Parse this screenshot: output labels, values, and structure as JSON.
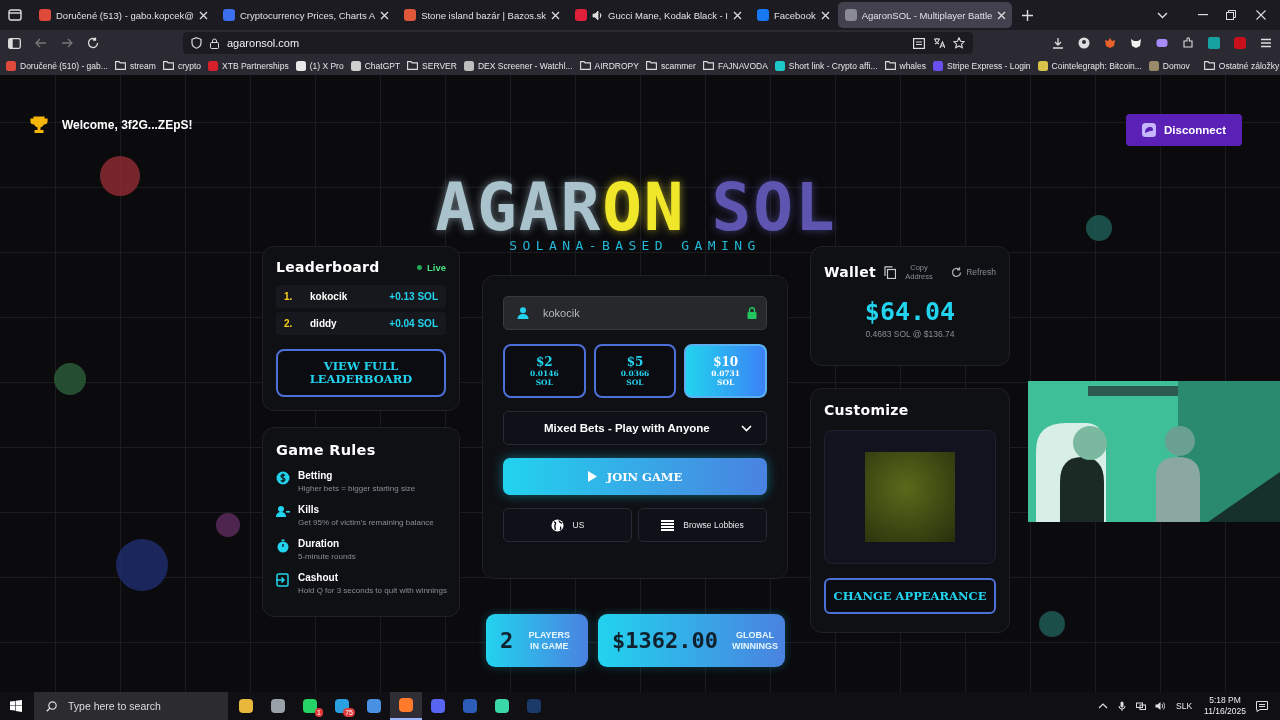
{
  "browser": {
    "tabs": [
      {
        "title": "Doručené (513) - gabo.kopcek@",
        "color": "#e04a3a",
        "audio": false,
        "selected": false
      },
      {
        "title": "Cryptocurrency Prices, Charts A",
        "color": "#3b6ff0",
        "audio": false,
        "selected": false
      },
      {
        "title": "Stone island bazár | Bazos.sk",
        "color": "#e0583a",
        "audio": false,
        "selected": false
      },
      {
        "title": "Gucci Mane, Kodak Black - I",
        "color": "#e0203a",
        "audio": true,
        "selected": false
      },
      {
        "title": "Facebook",
        "color": "#1877f2",
        "audio": false,
        "selected": false
      },
      {
        "title": "AgaronSOL - Multiplayer Battle",
        "color": "#8a8a96",
        "audio": false,
        "selected": true
      }
    ],
    "address": "agaronsol.com",
    "bookmarks": [
      {
        "label": "Doručené (510) - gab...",
        "kind": "site",
        "color": "#e04a3a"
      },
      {
        "label": "stream",
        "kind": "folder"
      },
      {
        "label": "crypto",
        "kind": "folder"
      },
      {
        "label": "XTB Partnerships",
        "kind": "site",
        "color": "#d8202a"
      },
      {
        "label": "(1) X Pro",
        "kind": "site",
        "color": "#e8e8e8"
      },
      {
        "label": "ChatGPT",
        "kind": "site",
        "color": "#cfcfcf"
      },
      {
        "label": "SERVER",
        "kind": "folder"
      },
      {
        "label": "DEX Screener - Watchl...",
        "kind": "site",
        "color": "#bdbdbd"
      },
      {
        "label": "AIRDROPY",
        "kind": "folder"
      },
      {
        "label": "scammer",
        "kind": "folder"
      },
      {
        "label": "FAJNAVODA",
        "kind": "folder"
      },
      {
        "label": "Short link - Crypto affi...",
        "kind": "site",
        "color": "#1ec8c8"
      },
      {
        "label": "whales",
        "kind": "folder"
      },
      {
        "label": "Stripe Express - Login",
        "kind": "site",
        "color": "#6a4ff0"
      },
      {
        "label": "Cointelegraph: Bitcoin...",
        "kind": "site",
        "color": "#d8c24a"
      },
      {
        "label": "Domov",
        "kind": "site",
        "color": "#9a8a6a"
      }
    ],
    "other_bookmarks": "Ostatné záložky"
  },
  "page": {
    "welcome": "Welcome, 3f2G...ZEpS!",
    "disconnect": "Disconnect",
    "logo": [
      {
        "text": "AGAR",
        "color": "#a9c2cc"
      },
      {
        "text": "ON",
        "color": "#f0e62a"
      },
      {
        "text": "SOL",
        "color": "#5e55b0"
      }
    ],
    "tagline": "SOLANA-BASED GAMING",
    "leaderboard": {
      "title": "Leaderboard",
      "status": "Live",
      "rows": [
        {
          "rank": "1.",
          "name": "kokocik",
          "amount": "+0.13 SOL"
        },
        {
          "rank": "2.",
          "name": "diddy",
          "amount": "+0.04 SOL"
        }
      ],
      "button": "VIEW FULL LEADERBOARD"
    },
    "rules": {
      "title": "Game Rules",
      "items": [
        {
          "kind": "betting",
          "title": "Betting",
          "text": "Higher bets = bigger starting size"
        },
        {
          "kind": "kills",
          "title": "Kills",
          "text": "Get 95% of victim's remaining balance"
        },
        {
          "kind": "duration",
          "title": "Duration",
          "text": "5-minute rounds"
        },
        {
          "kind": "cashout",
          "title": "Cashout",
          "text": "Hold Q for 3 seconds to quit with winnings"
        }
      ]
    },
    "username": "kokocik",
    "bets": [
      {
        "amount": "$2",
        "sol": "0.0146 SOL",
        "selected": false
      },
      {
        "amount": "$5",
        "sol": "0.0366 SOL",
        "selected": false
      },
      {
        "amount": "$10",
        "sol": "0.0731 SOL",
        "selected": true
      }
    ],
    "mode": "Mixed Bets - Play with Anyone",
    "join": "JOIN GAME",
    "region": "US",
    "browse": "Browse Lobbies",
    "stats": [
      {
        "value": "2",
        "label": "PLAYERS IN GAME"
      },
      {
        "value": "$1362.00",
        "label": "GLOBAL WINNINGS"
      }
    ],
    "wallet": {
      "title": "Wallet",
      "copy": "Copy Address",
      "refresh": "Refresh",
      "balance": "$64.04",
      "rate": "0.4683 SOL @ $136.74"
    },
    "customize": {
      "title": "Customize",
      "button": "CHANGE APPEARANCE"
    }
  },
  "taskbar": {
    "search_placeholder": "Type here to search",
    "apps": [
      {
        "color": "#e8b83a",
        "active": false
      },
      {
        "color": "#9aa0a8",
        "active": false
      },
      {
        "color": "#25d366",
        "active": false,
        "badge": "1"
      },
      {
        "color": "#2aa0e0",
        "active": false,
        "badge": "75"
      },
      {
        "color": "#4a90e2",
        "active": false
      },
      {
        "color": "#ff7a2a",
        "active": true
      },
      {
        "color": "#5865f2",
        "active": false
      },
      {
        "color": "#2b5cb8",
        "active": false
      },
      {
        "color": "#3ad8a8",
        "active": false
      },
      {
        "color": "#1b3a6a",
        "active": false
      }
    ],
    "language": "SLK",
    "time": "5:18 PM",
    "date": "11/16/2025"
  }
}
